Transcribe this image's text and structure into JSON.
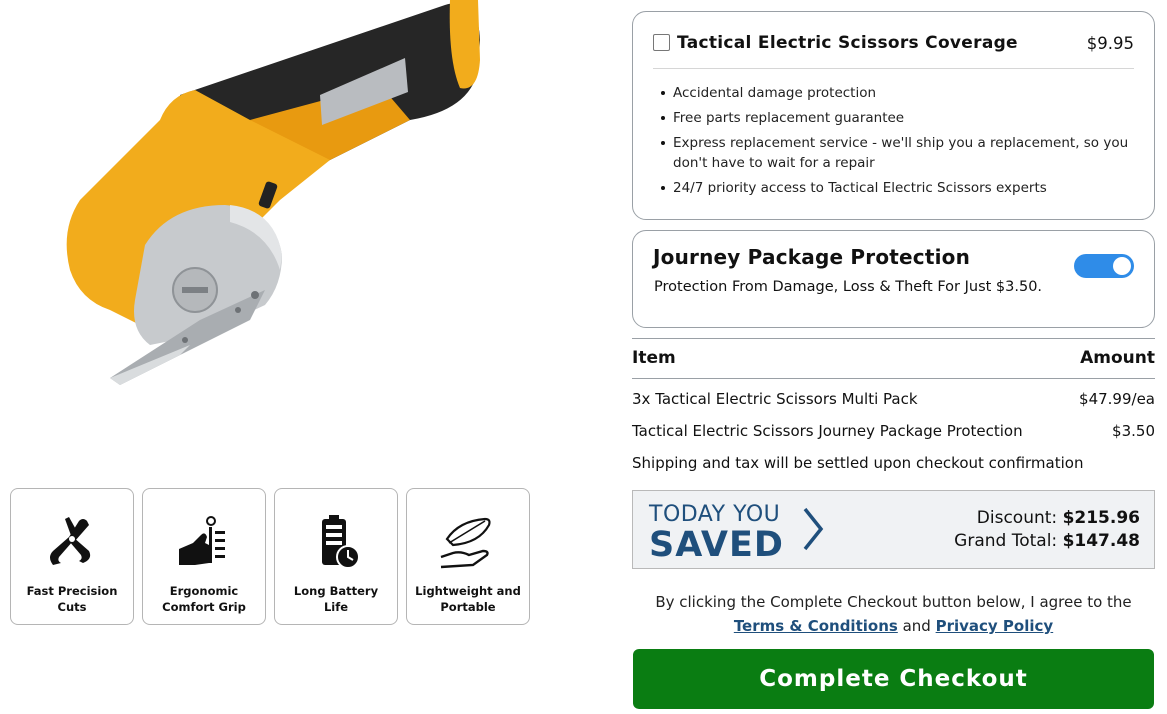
{
  "product": {
    "image_alt": "yellow electric scissors product photo"
  },
  "features": [
    {
      "icon": "pliers-icon",
      "label": "Fast Precision Cuts"
    },
    {
      "icon": "hand-grip-icon",
      "label": "Ergonomic Comfort Grip"
    },
    {
      "icon": "battery-clock-icon",
      "label": "Long Battery Life"
    },
    {
      "icon": "feather-hand-icon",
      "label": "Lightweight and Portable"
    }
  ],
  "coverage": {
    "title": "Tactical Electric Scissors Coverage",
    "price": "$9.95",
    "checked": false,
    "bullets": [
      "Accidental damage protection",
      "Free parts replacement guarantee",
      "Express replacement service - we'll ship you a replacement, so you don't have to wait for a repair",
      "24/7 priority access to Tactical Electric Scissors experts"
    ]
  },
  "journey": {
    "title": "Journey Package Protection",
    "subtitle": "Protection From Damage, Loss & Theft For Just $3.50.",
    "enabled": true
  },
  "order_table": {
    "header_item": "Item",
    "header_amount": "Amount",
    "rows": [
      {
        "item": "3x Tactical Electric Scissors Multi Pack",
        "amount": "$47.99/ea"
      },
      {
        "item": "Tactical Electric Scissors Journey Package Protection",
        "amount": "$3.50"
      }
    ],
    "shipping_note": "Shipping and tax will be settled upon checkout confirmation"
  },
  "savings": {
    "today_label": "TODAY YOU",
    "saved_label": "SAVED",
    "discount_label": "Discount:",
    "discount_value": "$215.96",
    "total_label": "Grand Total:",
    "total_value": "$147.48"
  },
  "agreement": {
    "text_before": "By clicking the Complete Checkout button below, I agree to the",
    "terms_link": "Terms & Conditions",
    "and_text": "and",
    "privacy_link": "Privacy Policy"
  },
  "checkout_button": "Complete Checkout",
  "colors": {
    "checkout_green": "#0a7d12",
    "toggle_blue": "#2f8ce8",
    "savings_navy": "#1f4f7c",
    "product_yellow": "#f2ac1c"
  }
}
